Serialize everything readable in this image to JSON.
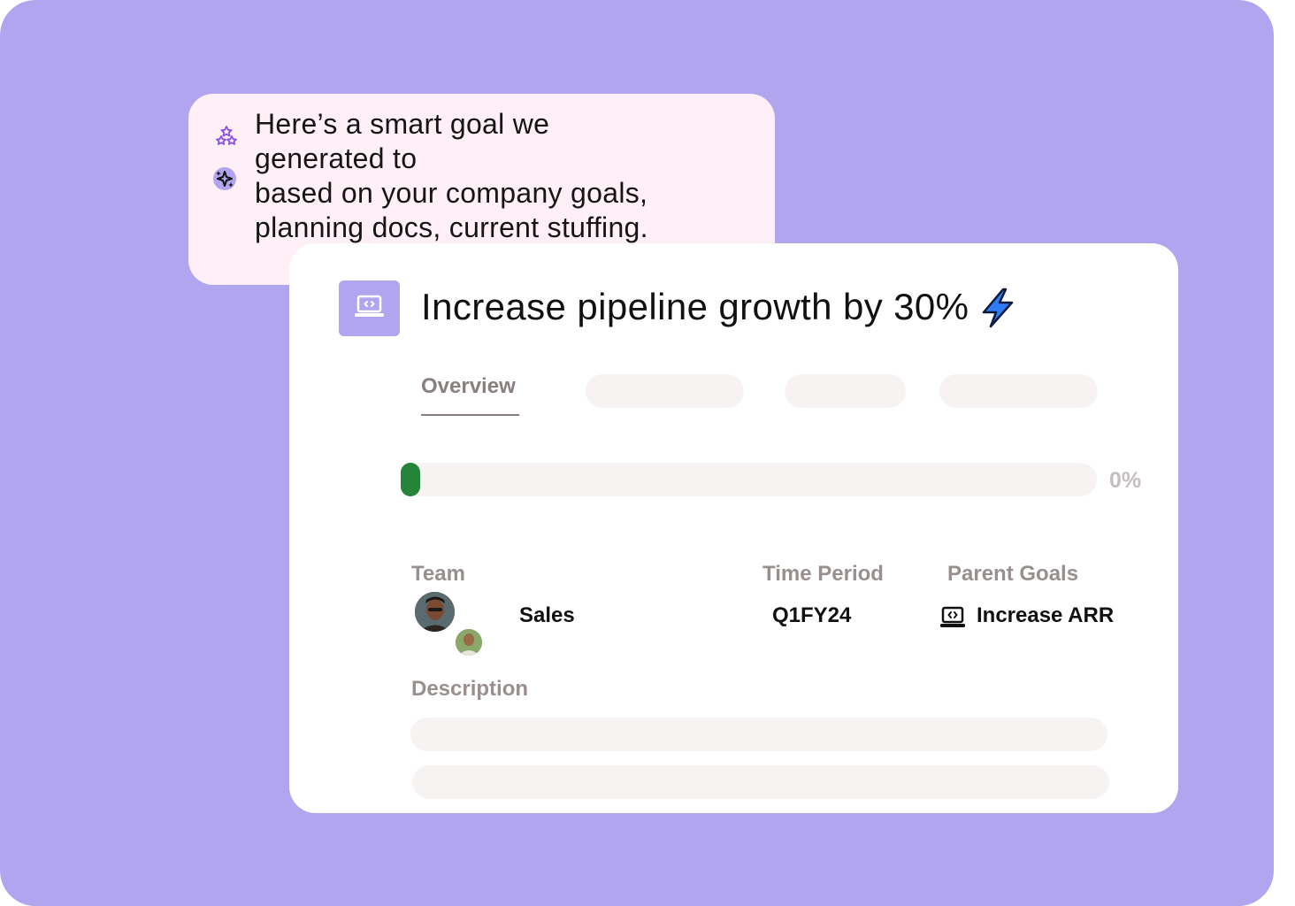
{
  "ai_message": {
    "lines": [
      "Here’s a smart goal we",
      "generated to",
      "based on your company goals,",
      "planning docs, current stuffing."
    ]
  },
  "goal": {
    "title": "Increase pipeline growth by 30%",
    "icon": "laptop-code-icon",
    "badge_icon": "lightning-bolt-icon"
  },
  "tabs": {
    "active_label": "Overview",
    "placeholder_count": 3
  },
  "progress": {
    "value_percent": 0,
    "label": "0%"
  },
  "fields": {
    "team_label": "Team",
    "team_value": "Sales",
    "time_period_label": "Time Period",
    "time_period_value": "Q1FY24",
    "parent_goals_label": "Parent Goals",
    "parent_goal_value": "Increase ARR",
    "description_label": "Description"
  },
  "colors": {
    "background": "#b0a5ee",
    "ai_bubble": "#fff0f8",
    "progress_fill": "#23843a",
    "bolt": "#2f7cf6",
    "placeholder": "#f6f3f2"
  }
}
